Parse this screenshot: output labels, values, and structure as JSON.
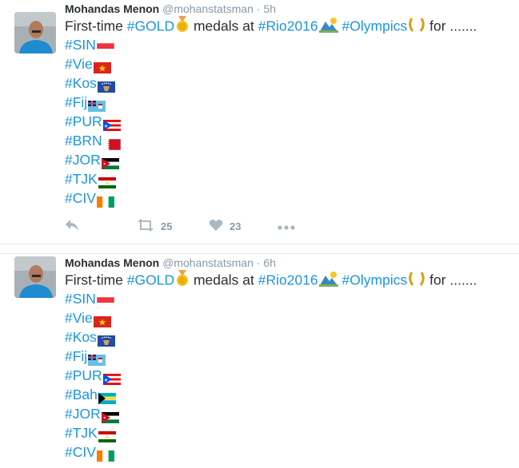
{
  "tweets": [
    {
      "author": "Mohandas Menon",
      "handle": "@mohanstatsman",
      "separator": "·",
      "time": "5h",
      "text_prefix": "First-time",
      "tag_gold": "#GOLD",
      "text_middle": "medals at",
      "tag_rio": "#Rio2016",
      "tag_olympics": "#Olympics",
      "text_suffix": "for .......",
      "country_tags": [
        "#SIN",
        "#Vie",
        "#Kos",
        "#Fij",
        "#PUR",
        "#BRN",
        "#JOR",
        "#TJK",
        "#CIV"
      ],
      "country_flags": [
        "sin",
        "vie",
        "kos",
        "fij",
        "pur",
        "brn",
        "jor",
        "tjk",
        "civ"
      ],
      "retweets": "25",
      "likes": "23"
    },
    {
      "author": "Mohandas Menon",
      "handle": "@mohanstatsman",
      "separator": "·",
      "time": "6h",
      "text_prefix": "First-time",
      "tag_gold": "#GOLD",
      "text_middle": "medals at",
      "tag_rio": "#Rio2016",
      "tag_olympics": "#Olympics",
      "text_suffix": "for .......",
      "country_tags": [
        "#SIN",
        "#Vie",
        "#Kos",
        "#Fij",
        "#PUR",
        "#Bah",
        "#JOR",
        "#TJK",
        "#CIV"
      ],
      "country_flags": [
        "sin",
        "vie",
        "kos",
        "fij",
        "pur",
        "bah",
        "jor",
        "tjk",
        "civ"
      ]
    }
  ],
  "icons": {
    "reply": "reply-icon",
    "retweet": "retweet-icon",
    "like": "heart-icon",
    "more": "more-icon"
  },
  "colors": {
    "hashtag": "#1b95e0",
    "name": "#292f33",
    "meta": "#8899a6",
    "action": "#aab8c2",
    "divider": "#e1e8ed"
  }
}
